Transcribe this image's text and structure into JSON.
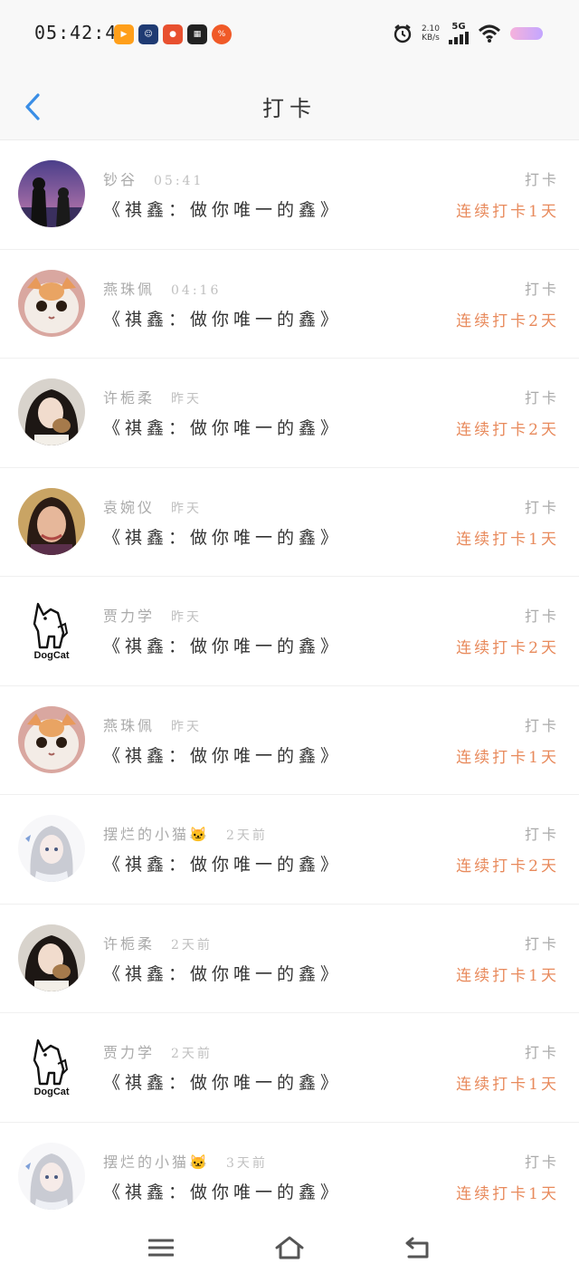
{
  "status": {
    "time": "05:42:43",
    "net_speed_value": "2.10",
    "net_speed_unit": "KB/s",
    "signal": "5G"
  },
  "header": {
    "title": "打卡"
  },
  "entries": [
    {
      "name": "钞谷",
      "time": "05:41",
      "book": "《祺鑫：做你唯一的鑫》",
      "label": "打卡",
      "streak": "连续打卡1天"
    },
    {
      "name": "燕珠佩",
      "time": "04:16",
      "book": "《祺鑫：做你唯一的鑫》",
      "label": "打卡",
      "streak": "连续打卡2天"
    },
    {
      "name": "许栀柔",
      "time": "昨天",
      "book": "《祺鑫：做你唯一的鑫》",
      "label": "打卡",
      "streak": "连续打卡2天"
    },
    {
      "name": "袁婉仪",
      "time": "昨天",
      "book": "《祺鑫：做你唯一的鑫》",
      "label": "打卡",
      "streak": "连续打卡1天"
    },
    {
      "name": "贾力学",
      "time": "昨天",
      "book": "《祺鑫：做你唯一的鑫》",
      "label": "打卡",
      "streak": "连续打卡2天"
    },
    {
      "name": "燕珠佩",
      "time": "昨天",
      "book": "《祺鑫：做你唯一的鑫》",
      "label": "打卡",
      "streak": "连续打卡1天"
    },
    {
      "name": "摆烂的小猫🐱",
      "time": "2天前",
      "book": "《祺鑫：做你唯一的鑫》",
      "label": "打卡",
      "streak": "连续打卡2天"
    },
    {
      "name": "许栀柔",
      "time": "2天前",
      "book": "《祺鑫：做你唯一的鑫》",
      "label": "打卡",
      "streak": "连续打卡1天"
    },
    {
      "name": "贾力学",
      "time": "2天前",
      "book": "《祺鑫：做你唯一的鑫》",
      "label": "打卡",
      "streak": "连续打卡1天"
    },
    {
      "name": "摆烂的小猫🐱",
      "time": "3天前",
      "book": "《祺鑫：做你唯一的鑫》",
      "label": "打卡",
      "streak": "连续打卡1天"
    }
  ],
  "avatar_brand": "DogCat",
  "colors": {
    "accent": "#3a8ee6",
    "streak": "#e88a5c"
  }
}
